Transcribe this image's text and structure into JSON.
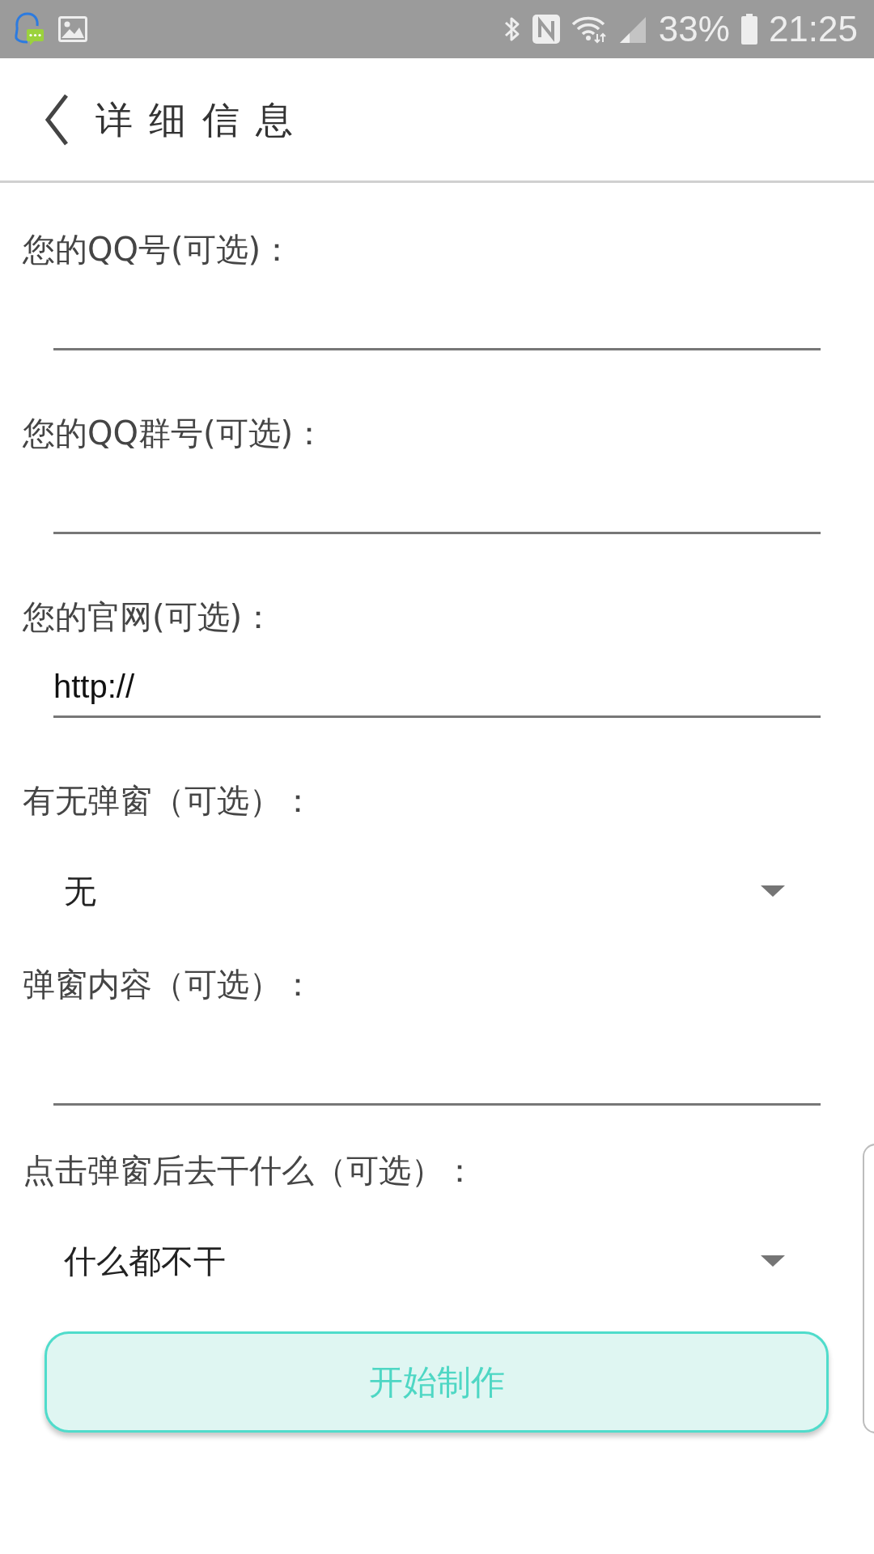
{
  "status_bar": {
    "battery": "33%",
    "time": "21:25"
  },
  "header": {
    "title": "详细信息"
  },
  "fields": [
    {
      "kind": "text",
      "label": "您的QQ号(可选)："
    },
    {
      "kind": "text",
      "label": "您的QQ群号(可选)："
    },
    {
      "kind": "text",
      "label": "您的官网(可选)：",
      "value": "http://"
    },
    {
      "kind": "select",
      "label": "有无弹窗（可选）：",
      "value": "无"
    },
    {
      "kind": "multiline",
      "label": "弹窗内容（可选）："
    },
    {
      "kind": "select",
      "label": "点击弹窗后去干什么（可选）：",
      "value": "什么都不干"
    }
  ],
  "submit_button": {
    "label": "开始制作"
  }
}
